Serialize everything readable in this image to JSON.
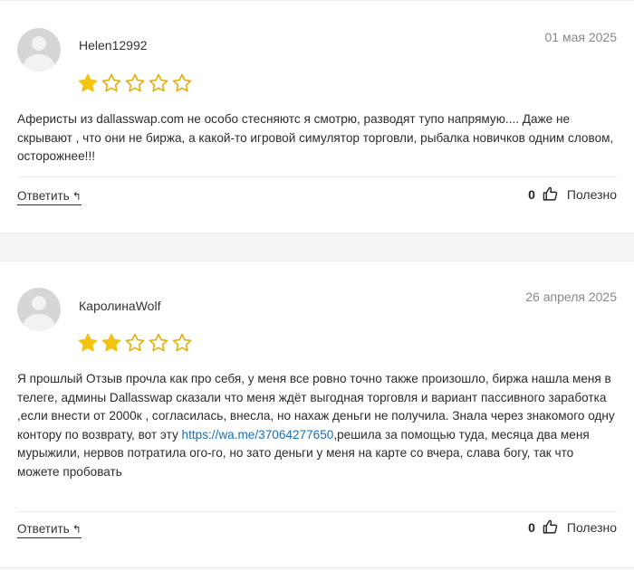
{
  "reviews": [
    {
      "author": "Helen12992",
      "date": "01 мая 2025",
      "rating": 1,
      "max_rating": 5,
      "text": "Аферисты из dallasswap.com не особо стесняютс я смотрю, разводят тупо напрямую.... Даже не скрывают , что они не биржа, а какой-то игровой симулятор торговли, рыбалка новичков одним словом, осторожнее!!!",
      "reply_label": "Ответить",
      "useful_count": "0",
      "useful_label": "Полезно"
    },
    {
      "author": "КаролинаWolf",
      "date": "26 апреля 2025",
      "rating": 2,
      "max_rating": 5,
      "text_before_link": "Я прошлый Отзыв прочла как про себя, у меня все ровно точно также произошло, биржа нашла меня в телеге, админы Dallasswap сказали что меня ждёт выгодная торговля и вариант пассивного заработка ,если внести от 2000к , согласилась, внесла, но нахаж деньги не получила. Знала через знакомого одну контору по возврату, вот эту ",
      "link_text": "https://wa.me/37064277650",
      "text_after_link": ",решила за помощью туда, месяца два меня мурыжили, нервов потратила ого-го, но зато деньги у меня на карте со вчера, слава богу, так что можете пробовать",
      "reply_label": "Ответить",
      "useful_count": "0",
      "useful_label": "Полезно"
    }
  ],
  "colors": {
    "star_filled": "#f1c40f",
    "star_outline": "#e2b007",
    "link": "#1a6fb5"
  },
  "icons": {
    "reply": "reply-arrow-icon",
    "useful": "thumbs-up-icon"
  }
}
